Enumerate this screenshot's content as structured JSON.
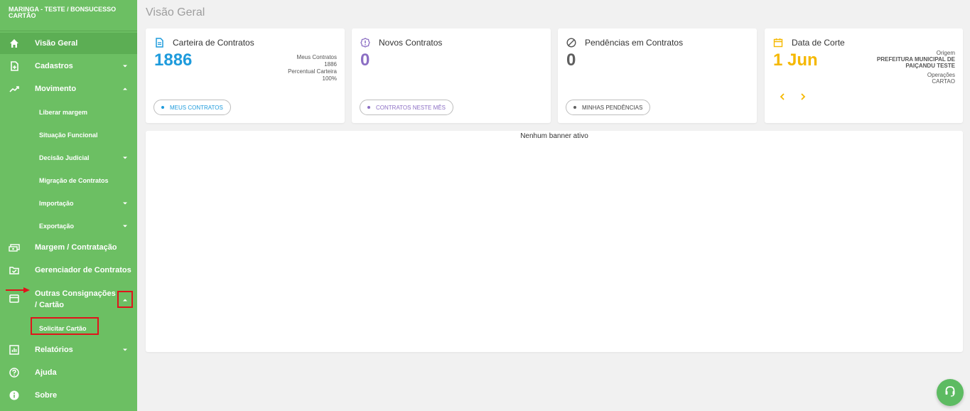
{
  "sidebar": {
    "company": "MARINGA - TESTE / BONSUCESSO CARTÃO",
    "items": [
      {
        "label": "Visão Geral",
        "icon": "home-icon"
      },
      {
        "label": "Cadastros",
        "icon": "add-document-icon"
      },
      {
        "label": "Movimento",
        "icon": "trending-up-icon"
      },
      {
        "label": "Liberar margem"
      },
      {
        "label": "Situação Funcional"
      },
      {
        "label": "Decisão Judicial"
      },
      {
        "label": "Migração de Contratos"
      },
      {
        "label": "Importação"
      },
      {
        "label": "Exportação"
      },
      {
        "label": "Margem / Contratação",
        "icon": "money-icon"
      },
      {
        "label": "Gerenciador de Contratos",
        "icon": "checked-folder-icon"
      },
      {
        "label": "Outras Consignações / Cartão",
        "icon": "card-icon"
      },
      {
        "label": "Solicitar Cartão"
      },
      {
        "label": "Relatórios",
        "icon": "chart-icon"
      },
      {
        "label": "Ajuda",
        "icon": "help-icon"
      },
      {
        "label": "Sobre",
        "icon": "info-icon"
      }
    ]
  },
  "page": {
    "title": "Visão Geral"
  },
  "cards": [
    {
      "title": "Carteira de Contratos",
      "value": "1886",
      "color": "#1e9bdc",
      "side": [
        "Meus Contratos",
        "1886",
        "Percentual Carteira",
        "100%"
      ],
      "pill": "MEUS CONTRATOS"
    },
    {
      "title": "Novos Contratos",
      "value": "0",
      "color": "#8c6fc4",
      "pill": "CONTRATOS NESTE MÊS"
    },
    {
      "title": "Pendências em Contratos",
      "value": "0",
      "color": "#5f5f5f",
      "pill": "MINHAS PENDÊNCIAS"
    },
    {
      "title": "Data de Corte",
      "value": "1 Jun",
      "color": "#f5b800",
      "side": [
        "Origem",
        "PREFEITURA MUNICIPAL DE",
        "PAIÇANDU TESTE",
        "Operações",
        "CARTAO"
      ]
    }
  ],
  "banner": {
    "text": "Nenhum banner ativo"
  },
  "colors": {
    "sidebar": "#6cbf63",
    "highlight": "#e0141b",
    "fab": "#5dbb62"
  }
}
